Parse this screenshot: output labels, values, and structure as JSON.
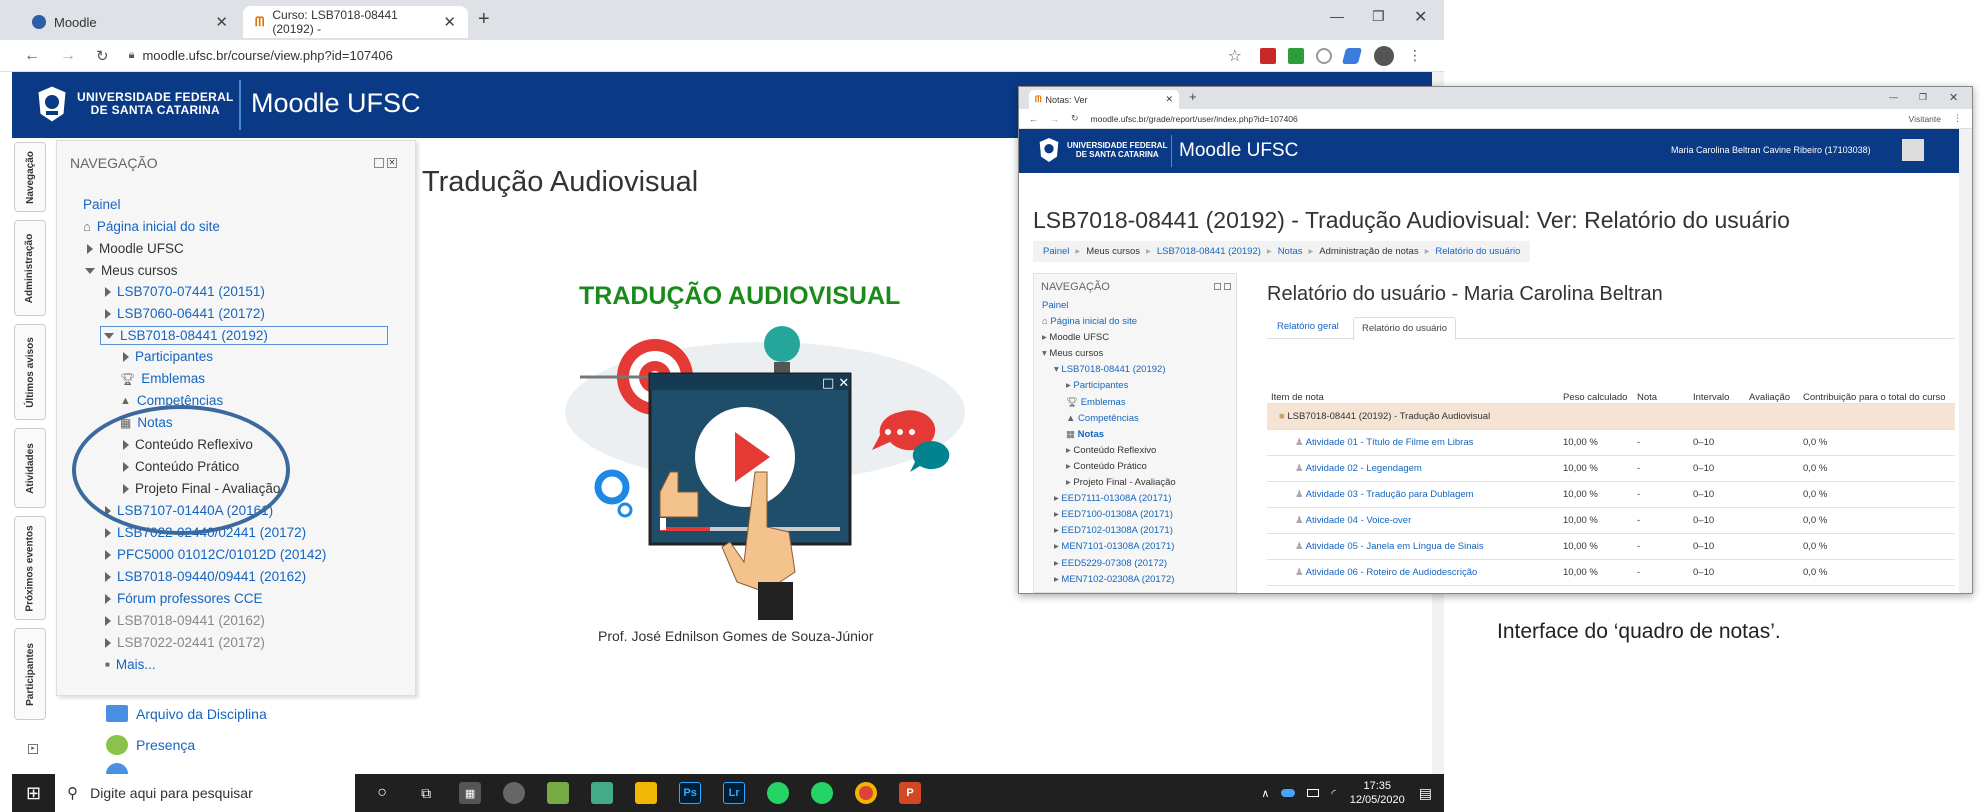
{
  "browser": {
    "tabs": [
      {
        "label": "Moodle"
      },
      {
        "label": "Curso: LSB7018-08441 (20192) -"
      }
    ],
    "url": "moodle.ufsc.br/course/view.php?id=107406"
  },
  "header": {
    "university_line1": "UNIVERSIDADE FEDERAL",
    "university_line2": "DE SANTA CATARINA",
    "site_name": "Moodle UFSC"
  },
  "side_tabs": [
    "Navegação",
    "Administração",
    "Últimos avisos",
    "Atividades",
    "Próximos eventos",
    "Participantes"
  ],
  "nav": {
    "title": "NAVEGAÇÃO",
    "painel": "Painel",
    "pagina_inicial": "Página inicial do site",
    "moodle_ufsc": "Moodle UFSC",
    "meus_cursos": "Meus cursos",
    "courses_top": [
      "LSB7070-07441 (20151)",
      "LSB7060-06441 (20172)"
    ],
    "current_course": "LSB7018-08441 (20192)",
    "current_items": [
      "Participantes",
      "Emblemas",
      "Competências",
      "Notas"
    ],
    "sections": [
      "Conteúdo Reflexivo",
      "Conteúdo Prático",
      "Projeto Final - Avaliação"
    ],
    "courses_bottom": [
      "LSB7107-01440A (20161)",
      "LSB7022-02440/02441 (20172)",
      "PFC5000 01012C/01012D (20142)",
      "LSB7018-09440/09441 (20162)",
      "Fórum professores CCE"
    ],
    "courses_gray": [
      "LSB7018-09441 (20162)",
      "LSB7022-02441 (20172)"
    ],
    "mais": "Mais..."
  },
  "main": {
    "course_title": "Tradução Audiovisual",
    "banner_title": "TRADUÇÃO AUDIOVISUAL",
    "professor": "Prof. José Ednilson Gomes de Souza-Júnior",
    "resources": [
      "Arquivo da Disciplina",
      "Presença"
    ]
  },
  "taskbar": {
    "search_placeholder": "Digite aqui para pesquisar",
    "time": "17:35",
    "date": "12/05/2020"
  },
  "second_window": {
    "tab": "Notas: Ver",
    "url": "moodle.ufsc.br/grade/report/user/index.php?id=107406",
    "visitor": "Visitante",
    "user": "Maria Carolina Beltran Cavine Ribeiro (17103038)",
    "page_title": "LSB7018-08441 (20192) - Tradução Audiovisual: Ver: Relatório do usuário",
    "breadcrumb": [
      "Painel",
      "Meus cursos",
      "LSB7018-08441 (20192)",
      "Notas",
      "Administração de notas",
      "Relatório do usuário"
    ],
    "nav_title": "NAVEGAÇÃO",
    "nav_items": [
      "Painel",
      "Página inicial do site",
      "Moodle UFSC",
      "Meus cursos",
      "LSB7018-08441 (20192)",
      "Participantes",
      "Emblemas",
      "Competências",
      "Notas",
      "Conteúdo Reflexivo",
      "Conteúdo Prático",
      "Projeto Final - Avaliação",
      "EED7111-01308A (20171)",
      "EED7100-01308A (20171)",
      "EED7102-01308A (20171)",
      "MEN7101-01308A (20171)",
      "EED5229-07308 (20172)",
      "MEN7102-02308A (20172)"
    ],
    "report_title": "Relatório do usuário - Maria Carolina Beltran",
    "report_tabs": [
      "Relatório geral",
      "Relatório do usuário"
    ],
    "columns": [
      "Item de nota",
      "Peso calculado",
      "Nota",
      "Intervalo",
      "Avaliação",
      "Contribuição para o total do curso"
    ],
    "category": "LSB7018-08441 (20192) - Tradução Audiovisual",
    "rows": [
      {
        "item": "Atividade 01 - Título de Filme em Libras",
        "peso": "10,00 %",
        "nota": "-",
        "intervalo": "0–10",
        "contrib": "0,0 %"
      },
      {
        "item": "Atividade 02 - Legendagem",
        "peso": "10,00 %",
        "nota": "-",
        "intervalo": "0–10",
        "contrib": "0,0 %"
      },
      {
        "item": "Atividade 03 - Tradução para Dublagem",
        "peso": "10,00 %",
        "nota": "-",
        "intervalo": "0–10",
        "contrib": "0,0 %"
      },
      {
        "item": "Atividade 04 - Voice-over",
        "peso": "10,00 %",
        "nota": "-",
        "intervalo": "0–10",
        "contrib": "0,0 %"
      },
      {
        "item": "Atividade 05 - Janela em Língua de Sinais",
        "peso": "10,00 %",
        "nota": "-",
        "intervalo": "0–10",
        "contrib": "0,0 %"
      },
      {
        "item": "Atividade 06 - Roteiro de Audiodescrição",
        "peso": "10,00 %",
        "nota": "-",
        "intervalo": "0–10",
        "contrib": "0,0 %"
      }
    ]
  },
  "caption": "Interface do ‘quadro de notas’.",
  "colors": {
    "header_blue": "#0a3a86",
    "banner_green": "#1a8a1a",
    "link": "#1565c0",
    "circle": "#3d6a9c"
  }
}
